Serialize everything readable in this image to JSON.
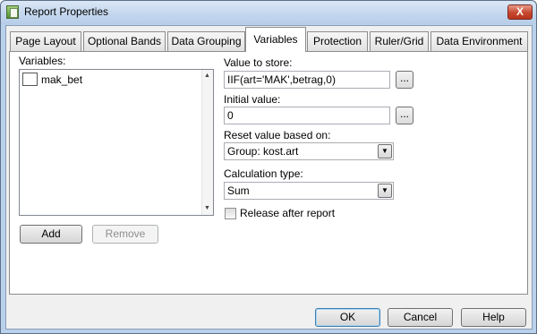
{
  "window": {
    "title": "Report Properties",
    "close_glyph": "X"
  },
  "tabs": [
    {
      "label": "Page Layout"
    },
    {
      "label": "Optional Bands"
    },
    {
      "label": "Data Grouping"
    },
    {
      "label": "Variables"
    },
    {
      "label": "Protection"
    },
    {
      "label": "Ruler/Grid"
    },
    {
      "label": "Data Environment"
    }
  ],
  "active_tab": "Variables",
  "variables_panel": {
    "list_label": "Variables:",
    "items": [
      {
        "name": "mak_bet",
        "checked": false
      }
    ],
    "add_label": "Add",
    "remove_label": "Remove",
    "value_to_store_label": "Value to store:",
    "value_to_store": "IIF(art='MAK',betrag,0)",
    "initial_value_label": "Initial value:",
    "initial_value": "0",
    "ellipsis": "...",
    "reset_label": "Reset value based on:",
    "reset_value": "Group: kost.art",
    "calc_type_label": "Calculation type:",
    "calc_type_value": "Sum",
    "release_after_report_label": "Release after report",
    "release_after_report_checked": false
  },
  "footer": {
    "ok_label": "OK",
    "cancel_label": "Cancel",
    "help_label": "Help"
  },
  "icons": {
    "app": "report-properties-icon",
    "close": "close-icon",
    "scroll_up": "scroll-up-arrow-icon",
    "scroll_down": "scroll-down-arrow-icon",
    "dropdown": "chevron-down-icon"
  }
}
